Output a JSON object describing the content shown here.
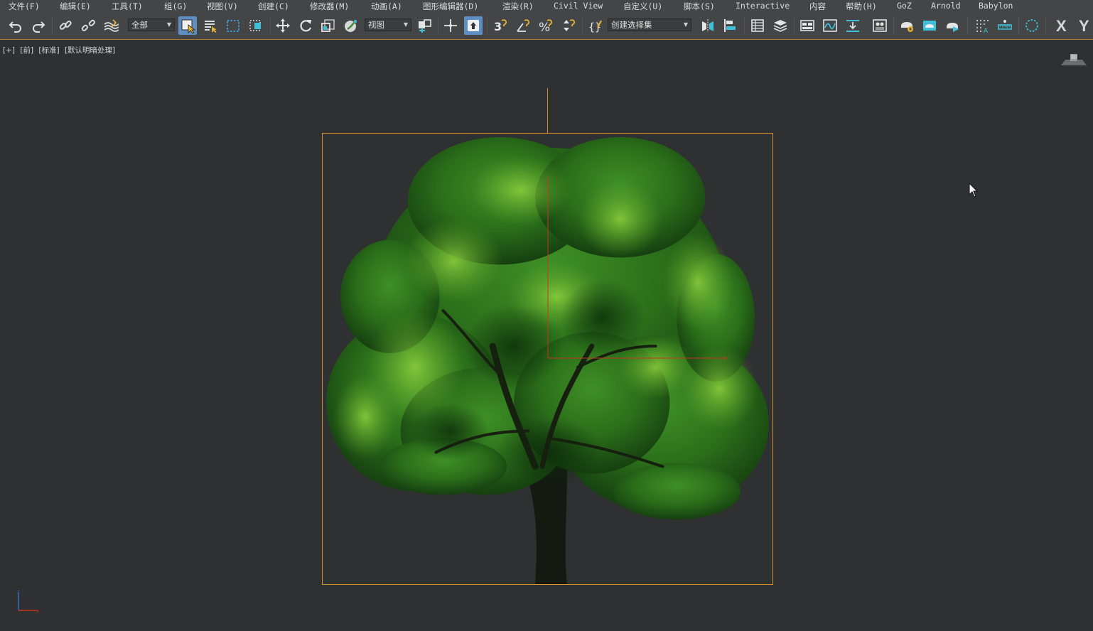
{
  "menu": [
    "文件(F)",
    "编辑(E)",
    "工具(T)",
    "组(G)",
    "视图(V)",
    "创建(C)",
    "修改器(M)",
    "动画(A)",
    "图形编辑器(D)",
    "渲染(R)",
    "Civil View",
    "自定义(U)",
    "脚本(S)",
    "Interactive",
    "内容",
    "帮助(H)",
    "GoZ",
    "Arnold",
    "Babylon"
  ],
  "toolbar": {
    "selection_filter": "全部",
    "reference_coord": "视图",
    "named_selection": "创建选择集",
    "axis_x": "X",
    "axis_y": "Y"
  },
  "viewport": {
    "label_parts": [
      "[+]",
      "[前]",
      "[标准]",
      "[默认明暗处理]"
    ]
  },
  "icons": {
    "undo": "undo-icon",
    "redo": "redo-icon",
    "link": "link-icon",
    "unlink": "unlink-icon",
    "bind_space_warp": "bind-space-warp-icon",
    "select": "select-object-icon",
    "select_by_name": "select-by-name-icon",
    "rect_region": "rectangular-region-icon",
    "window_crossing": "window-crossing-icon",
    "move": "move-icon",
    "rotate": "rotate-icon",
    "scale": "scale-icon",
    "placement": "placement-icon",
    "pivot": "pivot-icon",
    "manipulate": "manipulate-icon",
    "keyboard_shortcut": "keyboard-shortcut-icon",
    "snap_3d": "snap-3d-icon",
    "angle_snap": "angle-snap-icon",
    "percent_snap": "percent-snap-icon",
    "spinner_snap": "spinner-snap-icon",
    "edit_named_sel": "edit-named-selection-icon",
    "mirror": "mirror-icon",
    "align": "align-icon",
    "scene_explorer": "scene-explorer-icon",
    "layer_explorer": "layer-explorer-icon",
    "ribbon": "toggle-ribbon-icon",
    "curve_editor": "curve-editor-icon",
    "schematic": "schematic-view-icon",
    "material_editor": "material-editor-icon",
    "render_setup": "render-setup-icon",
    "rendered_frame": "rendered-frame-window-icon",
    "render": "render-production-icon",
    "grid_snap": "grid-snap-icon",
    "measure": "measure-icon",
    "selection_circle": "selection-circle-icon"
  },
  "colors": {
    "background": "#2f3031",
    "toolbar": "#444546",
    "selection": "#d6902e",
    "active_tool": "#5f8fc2",
    "tree_dark": "#0f2a0d",
    "tree_mid": "#2f7a1e",
    "tree_light": "#7cc43a"
  }
}
